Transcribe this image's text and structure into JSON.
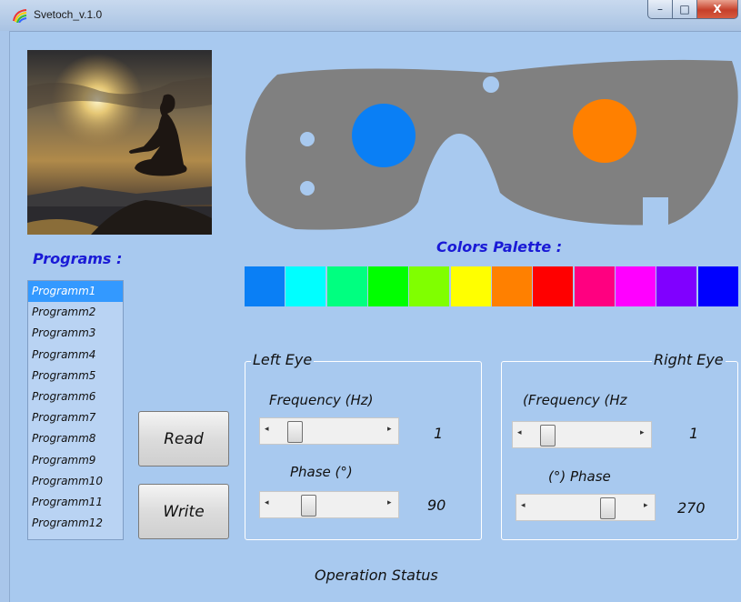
{
  "window": {
    "title": "Svetoch_v.1.0",
    "controls": {
      "minimize": "–",
      "maximize": "□",
      "close": "X"
    }
  },
  "goggles": {
    "left_led_color": "#0a7ff5",
    "right_led_color": "#ff8000",
    "body_color": "#808080"
  },
  "programs": {
    "label": "Programs :",
    "items": [
      "Programm1",
      "Programm2",
      "Programm3",
      "Programm4",
      "Programm5",
      "Programm6",
      "Programm7",
      "Programm8",
      "Programm9",
      "Programm10",
      "Programm11",
      "Programm12"
    ],
    "selected_index": 0
  },
  "buttons": {
    "read": "Read",
    "write": "Write"
  },
  "palette": {
    "label": "Colors Palette :",
    "colors": [
      "#0a7ff5",
      "#00ffff",
      "#00ff80",
      "#00ff00",
      "#80ff00",
      "#ffff00",
      "#ff8000",
      "#ff0000",
      "#ff0080",
      "#ff00ff",
      "#8000ff",
      "#0000ff"
    ]
  },
  "left_eye": {
    "title": "Left Eye",
    "frequency_label": "Frequency (Hz)",
    "frequency_value": "1",
    "phase_label": "Phase (°)",
    "phase_value": "90"
  },
  "right_eye": {
    "title": "Right Eye",
    "frequency_label": "(Frequency (Hz",
    "frequency_value": "1",
    "phase_label": "(°) Phase",
    "phase_value": "270"
  },
  "status": {
    "text": "Operation Status"
  }
}
